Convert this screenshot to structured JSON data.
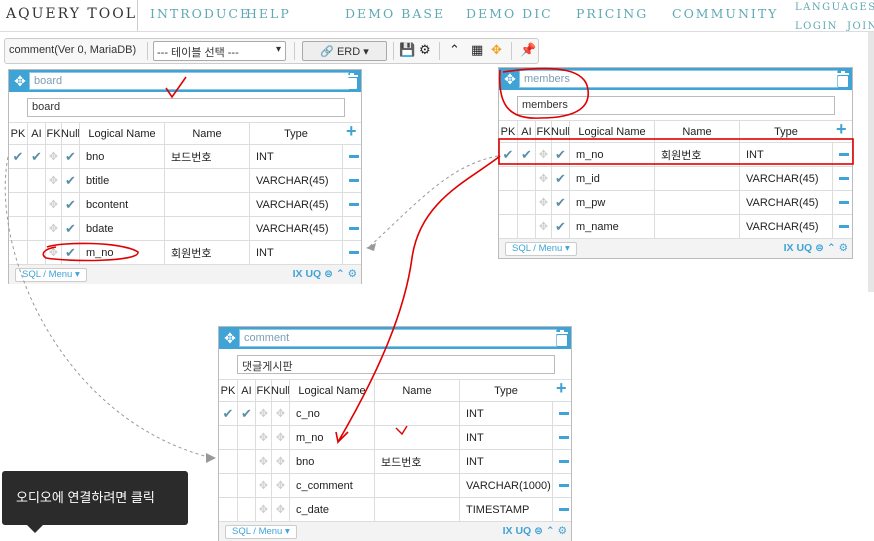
{
  "nav": {
    "brand": "AQUERY TOOL",
    "links": [
      "INTRODUCE",
      "HELP",
      "DEMO BASE",
      "DEMO DIC",
      "PRICING",
      "COMMUNITY"
    ],
    "languages": "LANGUAGES(K",
    "login": "LOGIN",
    "join": "JOIN"
  },
  "toolbar": {
    "project": "comment(Ver 0, MariaDB)",
    "table_select": "--- 테이블 선택 ---",
    "erd_button": "ERD"
  },
  "columns_header": [
    "PK",
    "AI",
    "FK",
    "Null",
    "Logical Name",
    "Name",
    "Type"
  ],
  "tables": [
    {
      "name": "board",
      "comment": "board",
      "rows": [
        {
          "pk": true,
          "ai": true,
          "fk": false,
          "null": true,
          "logical": "bno",
          "name": "보드번호",
          "type": "INT"
        },
        {
          "pk": false,
          "ai": false,
          "fk": false,
          "null": true,
          "logical": "btitle",
          "name": "",
          "type": "VARCHAR(45)"
        },
        {
          "pk": false,
          "ai": false,
          "fk": false,
          "null": true,
          "logical": "bcontent",
          "name": "",
          "type": "VARCHAR(45)"
        },
        {
          "pk": false,
          "ai": false,
          "fk": false,
          "null": true,
          "logical": "bdate",
          "name": "",
          "type": "VARCHAR(45)"
        },
        {
          "pk": false,
          "ai": false,
          "fk": false,
          "null": true,
          "logical": "m_no",
          "name": "회원번호",
          "type": "INT"
        }
      ]
    },
    {
      "name": "members",
      "comment": "members",
      "rows": [
        {
          "pk": true,
          "ai": true,
          "fk": false,
          "null": true,
          "logical": "m_no",
          "name": "회원번호",
          "type": "INT"
        },
        {
          "pk": false,
          "ai": false,
          "fk": false,
          "null": true,
          "logical": "m_id",
          "name": "",
          "type": "VARCHAR(45)"
        },
        {
          "pk": false,
          "ai": false,
          "fk": false,
          "null": true,
          "logical": "m_pw",
          "name": "",
          "type": "VARCHAR(45)"
        },
        {
          "pk": false,
          "ai": false,
          "fk": false,
          "null": true,
          "logical": "m_name",
          "name": "",
          "type": "VARCHAR(45)"
        }
      ]
    },
    {
      "name": "comment",
      "comment": "댓글게시판",
      "rows": [
        {
          "pk": true,
          "ai": true,
          "fk": false,
          "null": false,
          "logical": "c_no",
          "name": "",
          "type": "INT"
        },
        {
          "pk": false,
          "ai": false,
          "fk": false,
          "null": false,
          "logical": "m_no",
          "name": "",
          "type": "INT"
        },
        {
          "pk": false,
          "ai": false,
          "fk": false,
          "null": false,
          "logical": "bno",
          "name": "보드번호",
          "type": "INT"
        },
        {
          "pk": false,
          "ai": false,
          "fk": false,
          "null": false,
          "logical": "c_comment",
          "name": "",
          "type": "VARCHAR(1000)"
        },
        {
          "pk": false,
          "ai": false,
          "fk": false,
          "null": false,
          "logical": "c_date",
          "name": "",
          "type": "TIMESTAMP"
        }
      ]
    }
  ],
  "footer": {
    "sql_menu": "SQL / Menu",
    "icons": "IX UQ"
  },
  "toast": {
    "text": "오디오에 연결하려면 클릭"
  },
  "colors": {
    "table_header": "#3fa3d6",
    "nav_link": "#5fa9b5",
    "annotation": "#e00000"
  }
}
